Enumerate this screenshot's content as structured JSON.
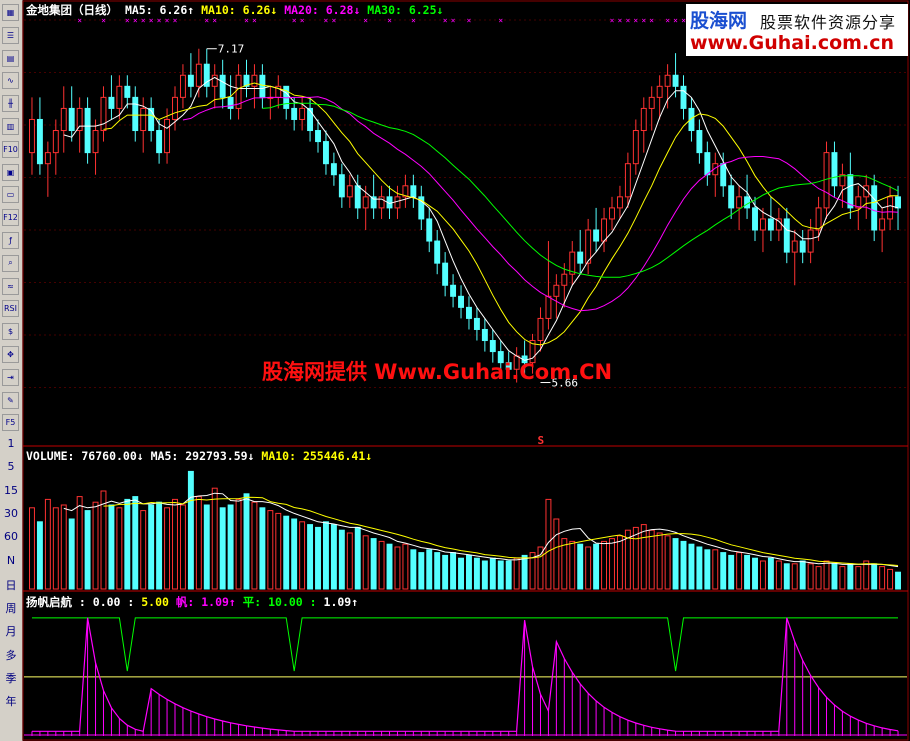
{
  "toolbar": {
    "icons": [
      "chart-icon",
      "list-icon",
      "grid-icon",
      "line-icon",
      "candle-icon",
      "report-icon",
      "f10-icon",
      "document-icon",
      "notes-icon",
      "f12-icon",
      "function-icon",
      "search-icon",
      "indicator-icon",
      "rsi-icon",
      "money-icon",
      "crosshair-icon",
      "export-icon",
      "pencil-icon",
      "f5-icon"
    ],
    "labels": {
      "f10": "F10",
      "f12": "F12",
      "rsi": "RSI",
      "f5": "F5"
    },
    "periods": [
      "1",
      "5",
      "15",
      "30",
      "60",
      "N",
      "日",
      "周",
      "月",
      "多",
      "季",
      "年"
    ]
  },
  "logo": {
    "title": "股海网",
    "tagline": "股票软件资源分享",
    "url": "www.Guhai.com.cn"
  },
  "watermark": "股海网提供 Www.Guhai.Com.CN",
  "price_header": {
    "name": "金地集团（日线）",
    "items": [
      {
        "label": "MA5:",
        "value": "6.26",
        "arrow": "↑",
        "color": "#ffffff"
      },
      {
        "label": "MA10:",
        "value": "6.26",
        "arrow": "↓",
        "color": "#ffff00"
      },
      {
        "label": "MA20:",
        "value": "6.28",
        "arrow": "↓",
        "color": "#ff00ff"
      },
      {
        "label": "MA30:",
        "value": "6.25",
        "arrow": "↓",
        "color": "#00ff00"
      }
    ]
  },
  "volume_header": {
    "items": [
      {
        "label": "VOLUME:",
        "value": "76760.00",
        "arrow": "↓",
        "color": "#ffffff"
      },
      {
        "label": "MA5:",
        "value": "292793.59",
        "arrow": "↓",
        "color": "#ffffff"
      },
      {
        "label": "MA10:",
        "value": "255446.41",
        "arrow": "↓",
        "color": "#ffff00"
      }
    ]
  },
  "indicator_header": {
    "name": "扬帆启航 :",
    "items": [
      {
        "value": "0.00 :",
        "color": "#ffffff"
      },
      {
        "value": "5.00",
        "color": "#ffff00"
      },
      {
        "label": "帆:",
        "value": "1.09",
        "arrow": "↑",
        "color": "#ff00ff"
      },
      {
        "label": "平:",
        "value": "10.00 :",
        "color": "#00ff00"
      },
      {
        "value": "1.09",
        "arrow": "↑",
        "color": "#ffffff"
      }
    ]
  },
  "colors": {
    "up": "#ff3232",
    "down": "#54ffff",
    "ma5": "#ffffff",
    "ma10": "#ffff00",
    "ma20": "#ff00ff",
    "ma30": "#00ff00",
    "grid": "#8b0000",
    "markers": "#ff00ff"
  },
  "chart_data": {
    "type": "candlestick",
    "ylim": [
      5.4,
      7.3
    ],
    "annotations": [
      {
        "text": "7.17",
        "index": 22,
        "value": 7.17
      },
      {
        "text": "5.66",
        "index": 64,
        "value": 5.66
      },
      {
        "text": "S",
        "index": 64
      }
    ],
    "ohlc": [
      [
        6.7,
        6.95,
        6.6,
        6.85
      ],
      [
        6.85,
        6.95,
        6.6,
        6.65
      ],
      [
        6.65,
        6.75,
        6.5,
        6.7
      ],
      [
        6.7,
        6.85,
        6.6,
        6.8
      ],
      [
        6.8,
        7.0,
        6.7,
        6.9
      ],
      [
        6.9,
        7.0,
        6.75,
        6.8
      ],
      [
        6.8,
        6.95,
        6.7,
        6.9
      ],
      [
        6.9,
        6.95,
        6.65,
        6.7
      ],
      [
        6.7,
        6.85,
        6.6,
        6.8
      ],
      [
        6.8,
        7.0,
        6.75,
        6.95
      ],
      [
        6.95,
        7.05,
        6.85,
        6.9
      ],
      [
        6.9,
        7.05,
        6.85,
        7.0
      ],
      [
        7.0,
        7.05,
        6.9,
        6.95
      ],
      [
        6.95,
        7.0,
        6.75,
        6.8
      ],
      [
        6.8,
        6.95,
        6.7,
        6.9
      ],
      [
        6.9,
        6.95,
        6.75,
        6.8
      ],
      [
        6.8,
        6.85,
        6.65,
        6.7
      ],
      [
        6.7,
        6.9,
        6.65,
        6.85
      ],
      [
        6.85,
        7.0,
        6.8,
        6.95
      ],
      [
        6.95,
        7.1,
        6.9,
        7.05
      ],
      [
        7.05,
        7.15,
        6.95,
        7.0
      ],
      [
        7.0,
        7.17,
        6.95,
        7.1
      ],
      [
        7.1,
        7.17,
        6.95,
        7.0
      ],
      [
        7.0,
        7.1,
        6.9,
        7.05
      ],
      [
        7.05,
        7.12,
        6.9,
        6.95
      ],
      [
        6.95,
        7.05,
        6.85,
        6.9
      ],
      [
        6.9,
        7.1,
        6.85,
        7.05
      ],
      [
        7.05,
        7.12,
        6.95,
        7.0
      ],
      [
        7.0,
        7.1,
        6.9,
        7.05
      ],
      [
        7.05,
        7.1,
        6.9,
        6.95
      ],
      [
        6.95,
        7.0,
        6.85,
        6.95
      ],
      [
        6.95,
        7.05,
        6.9,
        7.0
      ],
      [
        7.0,
        7.0,
        6.85,
        6.9
      ],
      [
        6.9,
        6.95,
        6.8,
        6.85
      ],
      [
        6.85,
        6.95,
        6.8,
        6.9
      ],
      [
        6.9,
        6.95,
        6.75,
        6.8
      ],
      [
        6.8,
        6.85,
        6.7,
        6.75
      ],
      [
        6.75,
        6.8,
        6.6,
        6.65
      ],
      [
        6.65,
        6.7,
        6.55,
        6.6
      ],
      [
        6.6,
        6.65,
        6.45,
        6.5
      ],
      [
        6.5,
        6.6,
        6.45,
        6.55
      ],
      [
        6.55,
        6.6,
        6.4,
        6.45
      ],
      [
        6.45,
        6.55,
        6.35,
        6.5
      ],
      [
        6.5,
        6.6,
        6.4,
        6.45
      ],
      [
        6.45,
        6.55,
        6.4,
        6.5
      ],
      [
        6.5,
        6.55,
        6.4,
        6.45
      ],
      [
        6.45,
        6.55,
        6.4,
        6.5
      ],
      [
        6.5,
        6.6,
        6.45,
        6.55
      ],
      [
        6.55,
        6.6,
        6.45,
        6.5
      ],
      [
        6.5,
        6.55,
        6.35,
        6.4
      ],
      [
        6.4,
        6.45,
        6.25,
        6.3
      ],
      [
        6.3,
        6.35,
        6.15,
        6.2
      ],
      [
        6.2,
        6.25,
        6.05,
        6.1
      ],
      [
        6.1,
        6.15,
        6.0,
        6.05
      ],
      [
        6.05,
        6.1,
        5.95,
        6.0
      ],
      [
        6.0,
        6.05,
        5.9,
        5.95
      ],
      [
        5.95,
        6.0,
        5.85,
        5.9
      ],
      [
        5.9,
        5.95,
        5.8,
        5.85
      ],
      [
        5.85,
        5.9,
        5.75,
        5.8
      ],
      [
        5.8,
        5.85,
        5.72,
        5.75
      ],
      [
        5.75,
        5.8,
        5.68,
        5.72
      ],
      [
        5.72,
        5.82,
        5.66,
        5.78
      ],
      [
        5.78,
        5.85,
        5.7,
        5.75
      ],
      [
        5.75,
        5.88,
        5.7,
        5.85
      ],
      [
        5.85,
        6.0,
        5.8,
        5.95
      ],
      [
        5.95,
        6.3,
        5.9,
        6.05
      ],
      [
        6.05,
        6.15,
        5.95,
        6.1
      ],
      [
        6.1,
        6.2,
        6.0,
        6.15
      ],
      [
        6.15,
        6.3,
        6.1,
        6.25
      ],
      [
        6.25,
        6.35,
        6.15,
        6.2
      ],
      [
        6.2,
        6.4,
        6.15,
        6.35
      ],
      [
        6.35,
        6.45,
        6.25,
        6.3
      ],
      [
        6.3,
        6.45,
        6.25,
        6.4
      ],
      [
        6.4,
        6.5,
        6.35,
        6.45
      ],
      [
        6.45,
        6.55,
        6.4,
        6.5
      ],
      [
        6.5,
        6.7,
        6.45,
        6.65
      ],
      [
        6.65,
        6.85,
        6.6,
        6.8
      ],
      [
        6.8,
        6.95,
        6.7,
        6.9
      ],
      [
        6.9,
        7.0,
        6.8,
        6.95
      ],
      [
        6.95,
        7.05,
        6.85,
        7.0
      ],
      [
        7.0,
        7.1,
        6.9,
        7.05
      ],
      [
        7.05,
        7.15,
        6.95,
        7.0
      ],
      [
        7.0,
        7.05,
        6.85,
        6.9
      ],
      [
        6.9,
        6.95,
        6.75,
        6.8
      ],
      [
        6.8,
        6.85,
        6.65,
        6.7
      ],
      [
        6.7,
        6.75,
        6.55,
        6.6
      ],
      [
        6.6,
        6.7,
        6.5,
        6.65
      ],
      [
        6.65,
        6.7,
        6.5,
        6.55
      ],
      [
        6.55,
        6.6,
        6.4,
        6.45
      ],
      [
        6.45,
        6.55,
        6.35,
        6.5
      ],
      [
        6.5,
        6.6,
        6.4,
        6.45
      ],
      [
        6.45,
        6.5,
        6.3,
        6.35
      ],
      [
        6.35,
        6.45,
        6.25,
        6.4
      ],
      [
        6.4,
        6.5,
        6.3,
        6.35
      ],
      [
        6.35,
        6.45,
        6.3,
        6.4
      ],
      [
        6.4,
        6.45,
        6.2,
        6.25
      ],
      [
        6.25,
        6.35,
        6.1,
        6.3
      ],
      [
        6.3,
        6.35,
        6.2,
        6.25
      ],
      [
        6.25,
        6.4,
        6.2,
        6.35
      ],
      [
        6.35,
        6.5,
        6.3,
        6.45
      ],
      [
        6.45,
        6.75,
        6.4,
        6.7
      ],
      [
        6.7,
        6.75,
        6.5,
        6.55
      ],
      [
        6.55,
        6.65,
        6.45,
        6.6
      ],
      [
        6.6,
        6.7,
        6.4,
        6.45
      ],
      [
        6.45,
        6.55,
        6.35,
        6.5
      ],
      [
        6.5,
        6.6,
        6.4,
        6.55
      ],
      [
        6.55,
        6.6,
        6.3,
        6.35
      ],
      [
        6.35,
        6.45,
        6.25,
        6.4
      ],
      [
        6.4,
        6.55,
        6.35,
        6.5
      ],
      [
        6.5,
        6.55,
        6.35,
        6.45
      ]
    ],
    "volume": [
      290,
      240,
      320,
      290,
      300,
      250,
      330,
      280,
      310,
      350,
      300,
      290,
      320,
      330,
      280,
      300,
      310,
      290,
      320,
      300,
      420,
      330,
      300,
      360,
      290,
      300,
      320,
      340,
      310,
      290,
      280,
      270,
      260,
      250,
      240,
      230,
      220,
      240,
      230,
      210,
      200,
      220,
      190,
      180,
      170,
      160,
      150,
      160,
      140,
      130,
      140,
      130,
      120,
      130,
      110,
      120,
      110,
      100,
      110,
      100,
      100,
      110,
      120,
      130,
      150,
      320,
      250,
      180,
      170,
      160,
      150,
      160,
      170,
      180,
      190,
      210,
      220,
      230,
      210,
      200,
      190,
      180,
      170,
      160,
      150,
      140,
      140,
      130,
      120,
      130,
      120,
      110,
      100,
      110,
      100,
      90,
      90,
      100,
      90,
      80,
      100,
      90,
      80,
      90,
      80,
      100,
      90,
      80,
      70,
      60
    ],
    "signal": [
      0.5,
      0.5,
      0.5,
      0.5,
      0.5,
      0.5,
      0.5,
      0.5,
      0.5,
      0.5,
      0.5,
      0.5,
      0.5,
      0.5,
      0.5,
      0.5,
      0.5,
      0.5,
      0.5,
      0.5,
      0.5,
      0.5,
      0.5,
      0.5,
      0.5,
      0.5,
      0.5,
      0.5,
      0.5,
      0.5,
      0.5,
      0.5,
      0.5,
      0.5,
      0.5,
      0.5,
      0.5,
      0.5,
      0.5,
      0.5,
      0.5,
      0.5,
      0.5,
      0.5,
      0.5,
      0.5,
      0.5,
      0.5,
      0.5,
      0.5,
      0.5,
      0.5,
      0.5,
      0.5,
      0.5,
      0.5,
      0.5,
      0.5,
      0.5,
      0.5,
      0.5,
      0.5,
      0.5,
      0.5,
      0.5,
      0.5,
      0.5,
      0.5,
      0.5,
      0.5,
      0.5,
      0.5,
      0.5,
      0.5,
      0.5,
      0.5,
      0.5,
      0.5,
      0.5,
      0.5,
      0.5,
      0.5,
      0.5,
      0.5,
      0.5,
      0.5,
      0.5,
      0.5,
      0.5,
      0.5,
      0.5,
      0.5,
      0.5,
      0.5,
      0.5,
      0.5,
      0.5,
      0.5,
      0.5,
      0.5,
      0.5,
      0.5,
      0.5,
      0.5,
      0.5,
      0.5,
      0.5,
      0.5,
      0.5,
      0.5
    ],
    "signal_lines": {
      "top": 10,
      "mid": 5,
      "base": 0
    },
    "signal_spikes": [
      {
        "start": 7,
        "peak": 10,
        "decay": 0.62
      },
      {
        "start": 15,
        "peak": 4,
        "decay": 0.88
      },
      {
        "start": 62,
        "peak": 9.8,
        "decay": 0.6
      },
      {
        "start": 66,
        "peak": 8,
        "decay": 0.82
      },
      {
        "start": 95,
        "peak": 10,
        "decay": 0.8
      }
    ],
    "signal_dips": [
      12,
      33,
      81
    ],
    "markers_top": [
      6,
      9,
      12,
      13,
      14,
      15,
      16,
      17,
      18,
      22,
      23,
      27,
      28,
      33,
      34,
      37,
      38,
      42,
      45,
      48,
      52,
      53,
      55,
      59,
      73,
      74,
      75,
      76,
      77,
      78,
      80,
      81,
      82,
      83,
      84,
      87,
      88,
      89,
      92,
      93,
      94
    ]
  }
}
